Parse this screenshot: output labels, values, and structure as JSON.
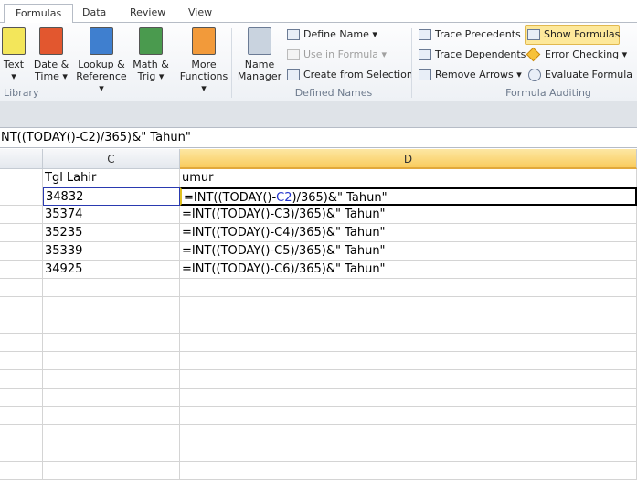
{
  "tabs": [
    "Formulas",
    "Data",
    "Review",
    "View"
  ],
  "library": {
    "items": [
      {
        "l1": "Text",
        "l2": "▾",
        "color": "#f3e65a"
      },
      {
        "l1": "Date &",
        "l2": "Time ▾",
        "color": "#e2572f"
      },
      {
        "l1": "Lookup &",
        "l2": "Reference ▾",
        "color": "#3f7fcf"
      },
      {
        "l1": "Math &",
        "l2": "Trig ▾",
        "color": "#4a9a4e"
      },
      {
        "l1": "More",
        "l2": "Functions ▾",
        "color": "#f29a3a"
      }
    ],
    "group": "Library"
  },
  "defined_names": {
    "name_manager": [
      "Name",
      "Manager"
    ],
    "define_name": "Define Name ▾",
    "use_in_formula": "Use in Formula ▾",
    "create_from_selection": "Create from Selection",
    "group": "Defined Names"
  },
  "auditing": {
    "trace_precedents": "Trace Precedents",
    "trace_dependents": "Trace Dependents",
    "remove_arrows": "Remove Arrows ▾",
    "show_formulas": "Show Formulas",
    "error_checking": "Error Checking ▾",
    "evaluate_formula": "Evaluate Formula",
    "group": "Formula Auditing"
  },
  "formula_bar": "NT((TODAY()-C2)/365)&\" Tahun\"",
  "columns": {
    "c": "C",
    "d": "D"
  },
  "header_row": {
    "c": "Tgl Lahir",
    "d": "umur"
  },
  "rows": [
    {
      "c": "34832",
      "d_pre": "=INT((TODAY()-",
      "d_ref": "C2",
      "d_post": ")/365)&\" Tahun\""
    },
    {
      "c": "35374",
      "d_pre": "=INT((TODAY()-C3)/365)&\" Tahun\"",
      "d_ref": "",
      "d_post": ""
    },
    {
      "c": "35235",
      "d_pre": "=INT((TODAY()-C4)/365)&\" Tahun\"",
      "d_ref": "",
      "d_post": ""
    },
    {
      "c": "35339",
      "d_pre": "=INT((TODAY()-C5)/365)&\" Tahun\"",
      "d_ref": "",
      "d_post": ""
    },
    {
      "c": "34925",
      "d_pre": "=INT((TODAY()-C6)/365)&\" Tahun\"",
      "d_ref": "",
      "d_post": ""
    }
  ]
}
